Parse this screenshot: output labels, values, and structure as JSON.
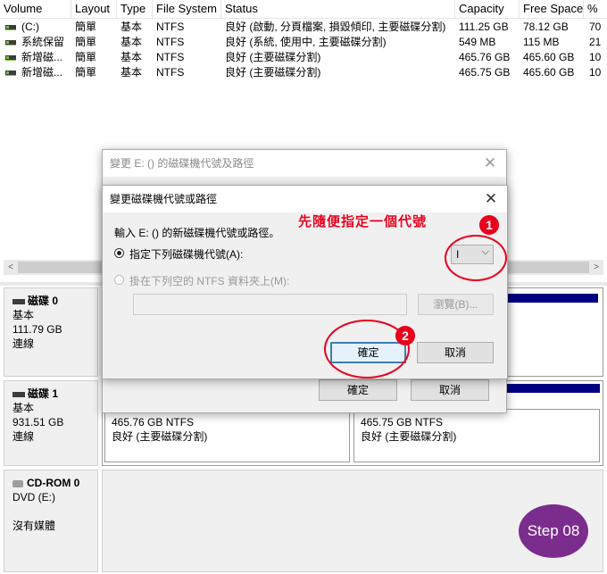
{
  "table": {
    "columns": [
      "Volume",
      "Layout",
      "Type",
      "File System",
      "Status",
      "Capacity",
      "Free Space",
      "%"
    ],
    "rows": [
      [
        "(C:)",
        "簡單",
        "基本",
        "NTFS",
        "良好 (啟動, 分頁檔案, 損毀傾印, 主要磁碟分割)",
        "111.25 GB",
        "78.12 GB",
        "70"
      ],
      [
        "系統保留",
        "簡單",
        "基本",
        "NTFS",
        "良好 (系統, 使用中, 主要磁碟分割)",
        "549 MB",
        "115 MB",
        "21"
      ],
      [
        "新增磁...",
        "簡單",
        "基本",
        "NTFS",
        "良好 (主要磁碟分割)",
        "465.76 GB",
        "465.60 GB",
        "10"
      ],
      [
        "新增磁...",
        "簡單",
        "基本",
        "NTFS",
        "良好 (主要磁碟分割)",
        "465.75 GB",
        "465.60 GB",
        "10"
      ]
    ]
  },
  "scrollbar": {
    "left_arrow": "<",
    "right_arrow": ">"
  },
  "disks": [
    {
      "name": "磁碟 0",
      "type": "基本",
      "size": "111.79 GB",
      "status": "連線"
    },
    {
      "name": "磁碟 1",
      "type": "基本",
      "size": "931.51 GB",
      "status": "連線",
      "partitions": [
        {
          "size": "465.76 GB NTFS",
          "status": "良好 (主要磁碟分割)"
        },
        {
          "size": "465.75 GB NTFS",
          "status": "良好 (主要磁碟分割)"
        }
      ]
    },
    {
      "name": "CD-ROM 0",
      "type": "DVD (E:)",
      "size": "",
      "status": "沒有媒體"
    }
  ],
  "outer_dialog": {
    "title": "變更 E: () 的磁碟機代號及路徑",
    "ok": "確定",
    "cancel": "取消"
  },
  "inner_dialog": {
    "title": "變更磁碟機代號或路徑",
    "prompt": "輸入 E: () 的新磁碟機代號或路徑。",
    "option_letter": "指定下列磁碟機代號(A):",
    "option_folder": "掛在下列空的 NTFS 資料夾上(M):",
    "selected_letter": "I",
    "browse": "瀏覽(B)...",
    "ok": "確定",
    "cancel": "取消"
  },
  "annotations": {
    "note": "先隨便指定一個代號",
    "badge1": "1",
    "badge2": "2",
    "step": "Step 08"
  },
  "colors": {
    "accent": "#3c7fb1",
    "partition_bar": "#000080",
    "annotation_red": "#e8001c",
    "step_badge": "#7b2d8e"
  }
}
